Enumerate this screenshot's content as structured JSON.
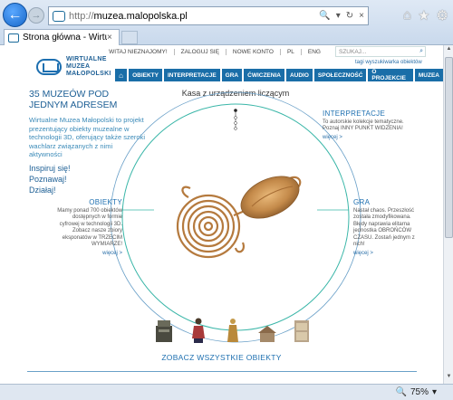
{
  "browser": {
    "back_symbol": "←",
    "forward_symbol": "→",
    "url_scheme": "http://",
    "url_host": "muzea.malopolska.pl",
    "tab_title": "Strona główna - Wirtualne ...",
    "tab_close": "×",
    "address_icons": [
      "🔍",
      "▾",
      "↻",
      "×"
    ],
    "toolbar_icons": [
      "home-icon",
      "star-icon",
      "gear-icon"
    ],
    "toolbar_symbols": [
      "⌂",
      "★",
      "⚙"
    ],
    "zoom_icon": "🔍",
    "zoom": "75%",
    "zoom_arrow": "▾"
  },
  "site": {
    "topbar": {
      "items": [
        "WITAJ NIEZNAJOMY!",
        "ZALOGUJ SIĘ",
        "NOWE KONTO",
        "PL",
        "ENG"
      ],
      "search_placeholder": "SZUKAJ..."
    },
    "logo_lines": [
      "WIRTUALNE",
      "MUZEA",
      "MAŁOPOLSKI"
    ],
    "tags_line": "tagi  wyszukiwarka obiektów",
    "menu": [
      "OBIEKTY",
      "INTERPRETACJE",
      "GRA",
      "ĆWICZENIA",
      "AUDIO",
      "SPOŁECZNOŚĆ",
      "O PROJEKCIE",
      "MUZEA"
    ],
    "headline": "35 MUZEÓW POD JEDNYM ADRESEM",
    "intro": "Wirtualne Muzea Małopolski to projekt prezentujący obiekty muzealne w technologii 3D, oferujący także szeroki wachlarz związanych z nimi aktywności",
    "cta": [
      "Inspiruj się!",
      "Poznawaj!",
      "Działaj!"
    ],
    "center_title": "Kasa z urządzeniem liczącym",
    "interpretacje": {
      "title": "INTERPRETACJE",
      "text": "To autorskie kolekcje tematyczne. Poznaj INNY PUNKT WIDZENIA!",
      "more": "więcej >"
    },
    "gra": {
      "title": "GRA",
      "text": "Nastał chaos. Przeszłość została zmodyfikowana. Błędy naprawia elitarna jednostka OBROŃCÓW CZASU. Zostań jednym z nich!",
      "more": "więcej >"
    },
    "obiekty": {
      "title": "OBIEKTY",
      "text": "Mamy ponad 700 obiektów dostępnych w formie cyfrowej w technologii 3D. Zobacz nasze zbiory eksponatów w TRZECIM WYMIARZE!",
      "more": "więcej >"
    },
    "all_objects": "ZOBACZ WSZYSTKIE OBIEKTY"
  },
  "colors": {
    "brand": "#1a6ea8",
    "teal": "#3ab6a8",
    "bronze": "#c48a4a"
  }
}
